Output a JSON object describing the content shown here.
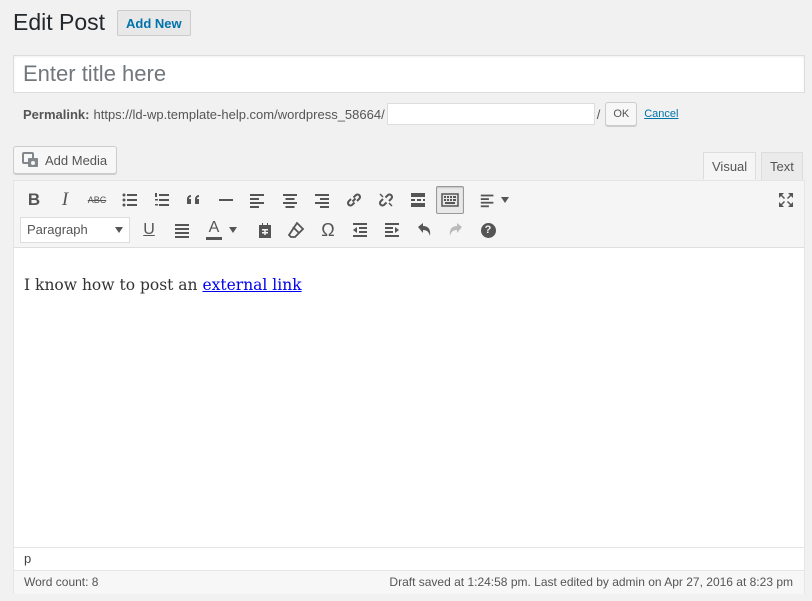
{
  "header": {
    "title": "Edit Post",
    "add_new": "Add New"
  },
  "title_field": {
    "placeholder": "Enter title here",
    "value": ""
  },
  "permalink": {
    "label": "Permalink:",
    "base_url": "https://ld-wp.template-help.com/wordpress_58664/",
    "slug": "",
    "slash": "/",
    "ok": "OK",
    "cancel": "Cancel"
  },
  "media": {
    "add_media": "Add Media"
  },
  "tabs": {
    "visual": "Visual",
    "text": "Text",
    "active": "visual"
  },
  "toolbar": {
    "row1": [
      "bold-icon",
      "italic-icon",
      "strikethrough-icon",
      "bulleted-list-icon",
      "numbered-list-icon",
      "blockquote-icon",
      "horizontal-line-icon",
      "align-left-icon",
      "align-center-icon",
      "align-right-icon",
      "insert-link-icon",
      "remove-link-icon",
      "read-more-icon",
      "toolbar-toggle-icon",
      "alignment-dropdown-icon",
      "fullscreen-icon"
    ],
    "row2": [
      "format-select",
      "underline-icon",
      "justify-icon",
      "text-color-icon",
      "paste-text-icon",
      "clear-formatting-icon",
      "special-character-icon",
      "outdent-icon",
      "indent-icon",
      "undo-icon",
      "redo-icon",
      "help-icon"
    ],
    "format_value": "Paragraph",
    "bold_glyph": "B",
    "italic_glyph": "I",
    "strike_glyph": "ABC",
    "underline_glyph": "U",
    "color_glyph": "A",
    "omega_glyph": "Ω",
    "help_glyph": "?"
  },
  "editor": {
    "text_before": "I know how to post an ",
    "link_text": "external link"
  },
  "status": {
    "path": "p",
    "word_count": "Word count: 8",
    "draft": "Draft saved at 1:24:58 pm. Last edited by admin on Apr 27, 2016 at 8:23 pm"
  },
  "colors": {
    "link": "#0073aa",
    "background": "#f1f1f1",
    "toolbar": "#f5f5f5"
  }
}
